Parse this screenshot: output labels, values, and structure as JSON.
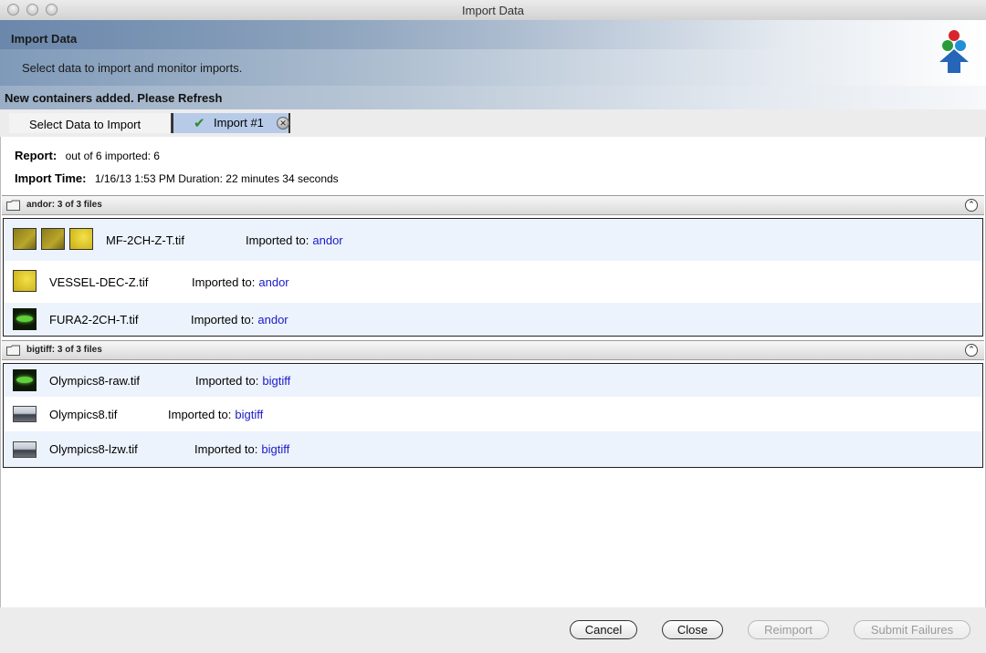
{
  "window": {
    "title": "Import Data"
  },
  "banner": {
    "title": "Import Data",
    "subtitle": "Select data to import and monitor imports.",
    "warning": "New containers added. Please Refresh"
  },
  "tabs": [
    {
      "label": "Select Data to Import",
      "selected": false
    },
    {
      "label": "Import #1",
      "selected": true,
      "status_icon": "check-icon"
    }
  ],
  "report": {
    "report_label": "Report:",
    "report_value": "out of 6 imported: 6",
    "time_label": "Import Time:",
    "time_value": "1/16/13 1:53 PM Duration:  22 minutes 34 seconds"
  },
  "imported_to_label": "Imported to:",
  "groups": [
    {
      "title": "andor: 3 of 3 files",
      "files": [
        {
          "name": "MF-2CH-Z-T.tif",
          "destination": "andor"
        },
        {
          "name": "VESSEL-DEC-Z.tif",
          "destination": "andor"
        },
        {
          "name": "FURA2-2CH-T.tif",
          "destination": "andor"
        }
      ]
    },
    {
      "title": "bigtiff: 3 of 3 files",
      "files": [
        {
          "name": "Olympics8-raw.tif",
          "destination": "bigtiff"
        },
        {
          "name": "Olympics8.tif",
          "destination": "bigtiff"
        },
        {
          "name": "Olympics8-lzw.tif",
          "destination": "bigtiff"
        }
      ]
    }
  ],
  "buttons": {
    "cancel": "Cancel",
    "close": "Close",
    "reimport": "Reimport",
    "submit_failures": "Submit Failures"
  },
  "colors": {
    "link": "#1a1ac8",
    "selected_tab": "#b7cbe8",
    "row_alt": "#edf3fc"
  }
}
